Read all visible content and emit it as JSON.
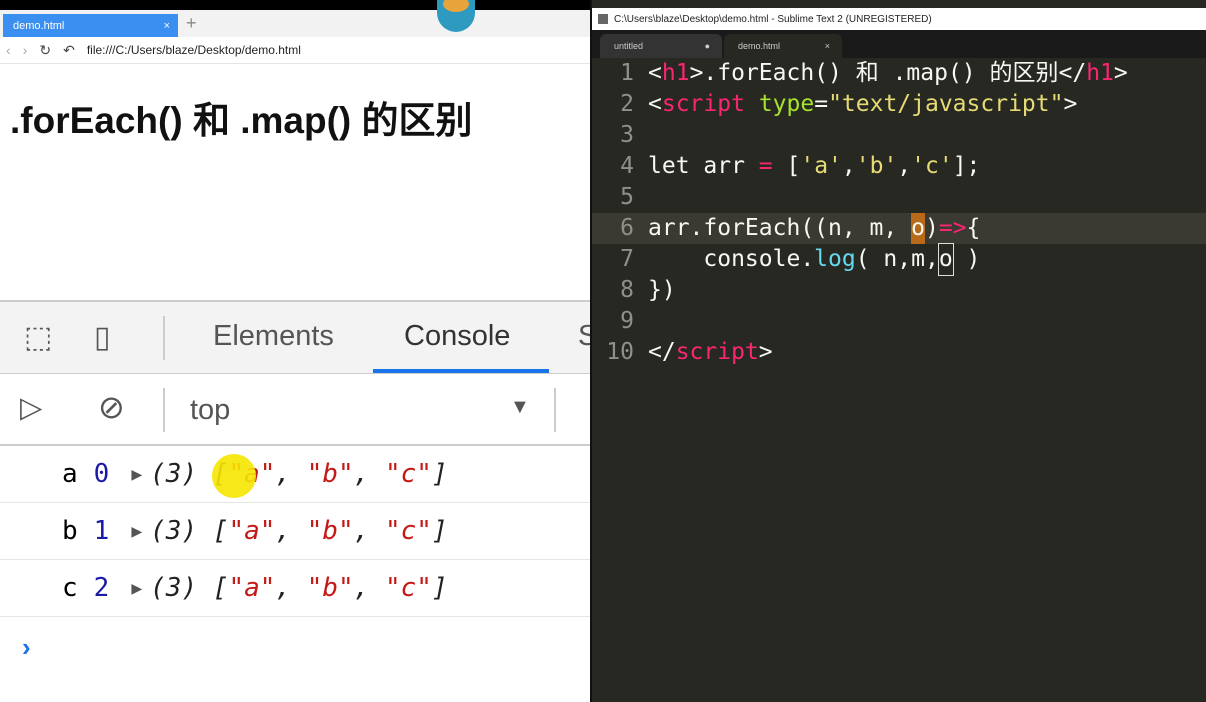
{
  "browser": {
    "tab_title": "demo.html",
    "tab_close": "×",
    "new_tab": "+",
    "url": "file:///C:/Users/blaze/Desktop/demo.html",
    "back": "‹",
    "forward": "›",
    "reload": "↻",
    "undo": "↶",
    "heading": ".forEach() 和 .map() 的区别"
  },
  "devtools": {
    "tabs": [
      "Elements",
      "Console",
      "S"
    ],
    "context": "top",
    "context_arrow": "▼",
    "rows": [
      {
        "val": "a",
        "idx": "0",
        "len": "(3)",
        "items": [
          "\"a\"",
          "\"b\"",
          "\"c\""
        ]
      },
      {
        "val": "b",
        "idx": "1",
        "len": "(3)",
        "items": [
          "\"a\"",
          "\"b\"",
          "\"c\""
        ]
      },
      {
        "val": "c",
        "idx": "2",
        "len": "(3)",
        "items": [
          "\"a\"",
          "\"b\"",
          "\"c\""
        ]
      }
    ],
    "prompt": "›"
  },
  "sublime": {
    "title": "C:\\Users\\blaze\\Desktop\\demo.html - Sublime Text 2 (UNREGISTERED)",
    "tabs": [
      {
        "label": "untitled",
        "mark": "●"
      },
      {
        "label": "demo.html",
        "mark": "×"
      }
    ],
    "lines": [
      [
        [
          "p",
          "<"
        ],
        [
          "tag",
          "h1"
        ],
        [
          "p",
          ">.forEach() 和 .map() 的区别</"
        ],
        [
          "tag",
          "h1"
        ],
        [
          "p",
          ">"
        ]
      ],
      [
        [
          "p",
          "<"
        ],
        [
          "tag",
          "script"
        ],
        [
          "p",
          " "
        ],
        [
          "attr",
          "type"
        ],
        [
          "p",
          "="
        ],
        [
          "str",
          "\"text/javascript\""
        ],
        [
          "p",
          ">"
        ]
      ],
      [],
      [
        [
          "p",
          "let arr "
        ],
        [
          "op",
          "="
        ],
        [
          "p",
          " ["
        ],
        [
          "str",
          "'a'"
        ],
        [
          "p",
          ","
        ],
        [
          "str",
          "'b'"
        ],
        [
          "p",
          ","
        ],
        [
          "str",
          "'c'"
        ],
        [
          "p",
          "];"
        ]
      ],
      [],
      [
        [
          "p",
          "arr.forEach((n, m, "
        ],
        [
          "sel",
          "o"
        ],
        [
          "p",
          ")"
        ],
        [
          "op",
          "=>"
        ],
        [
          "p",
          "{"
        ]
      ],
      [
        [
          "p",
          "    console."
        ],
        [
          "fn",
          "log"
        ],
        [
          "p",
          "( n,m,"
        ],
        [
          "box",
          "o"
        ],
        [
          "p",
          " )"
        ]
      ],
      [
        [
          "p",
          "})"
        ]
      ],
      [],
      [
        [
          "p",
          "</"
        ],
        [
          "tag",
          "script"
        ],
        [
          "p",
          ">"
        ]
      ]
    ]
  }
}
